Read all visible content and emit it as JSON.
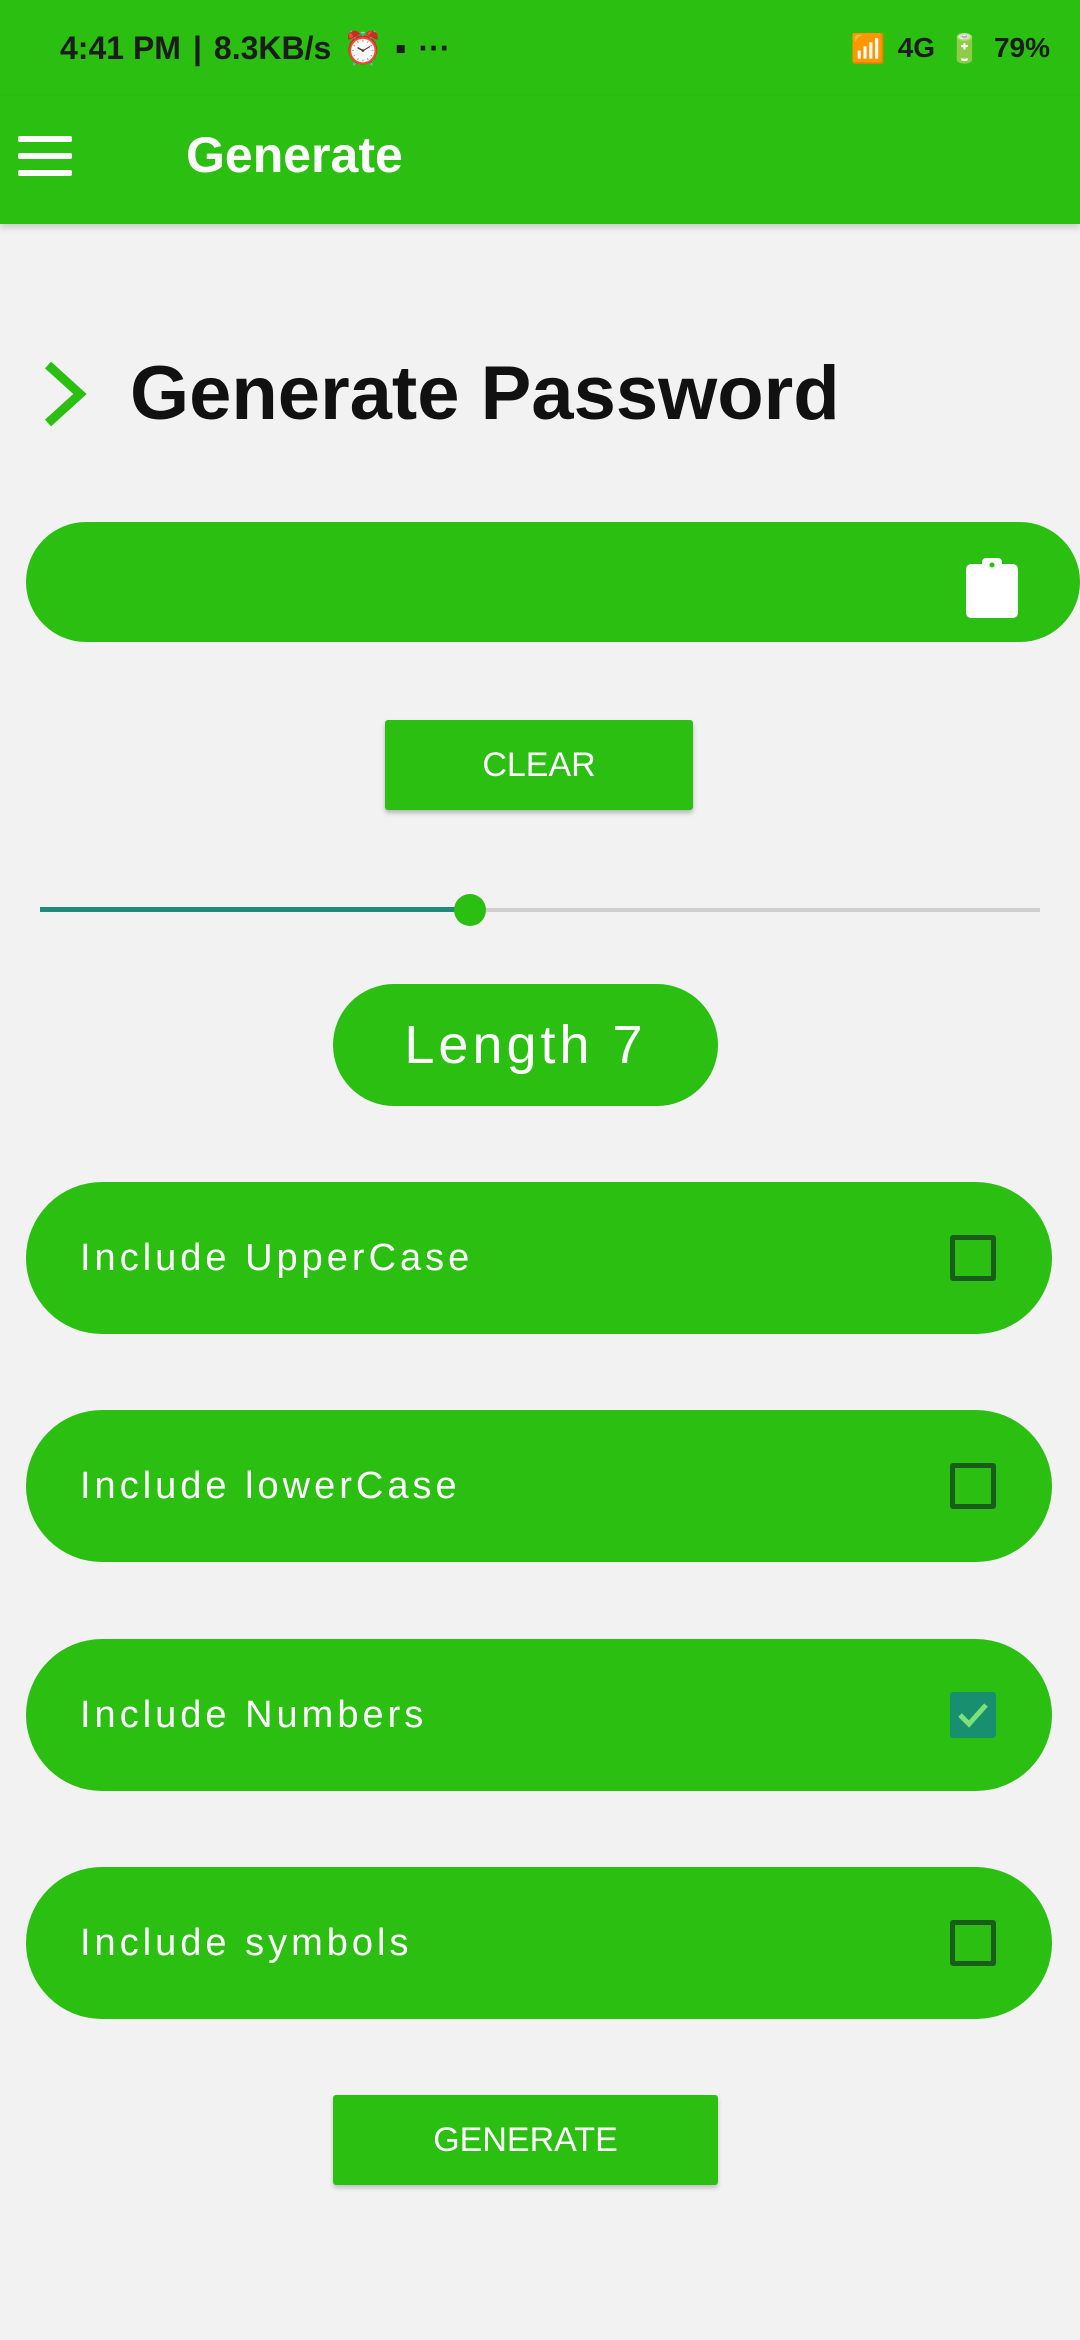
{
  "status_bar": {
    "time": "4:41 PM",
    "speed": "8.3KB/s",
    "overflow": "···",
    "network": "4G",
    "battery": "79%"
  },
  "appbar": {
    "title": "Generate"
  },
  "section": {
    "title": "Generate Password"
  },
  "password_field": {
    "value": ""
  },
  "clear_button": {
    "label": "CLEAR"
  },
  "slider": {
    "value_fraction": 0.43
  },
  "length": {
    "label": "Length 7"
  },
  "options": [
    {
      "label": "Include UpperCase",
      "checked": false
    },
    {
      "label": "Include lowerCase",
      "checked": false
    },
    {
      "label": "Include Numbers",
      "checked": true
    },
    {
      "label": "Include symbols",
      "checked": false
    }
  ],
  "generate_button": {
    "label": "GENERATE"
  },
  "colors": {
    "accent": "#2bbf12",
    "checkbox_checked": "#18906f",
    "slider_fill": "#1f8a78"
  }
}
